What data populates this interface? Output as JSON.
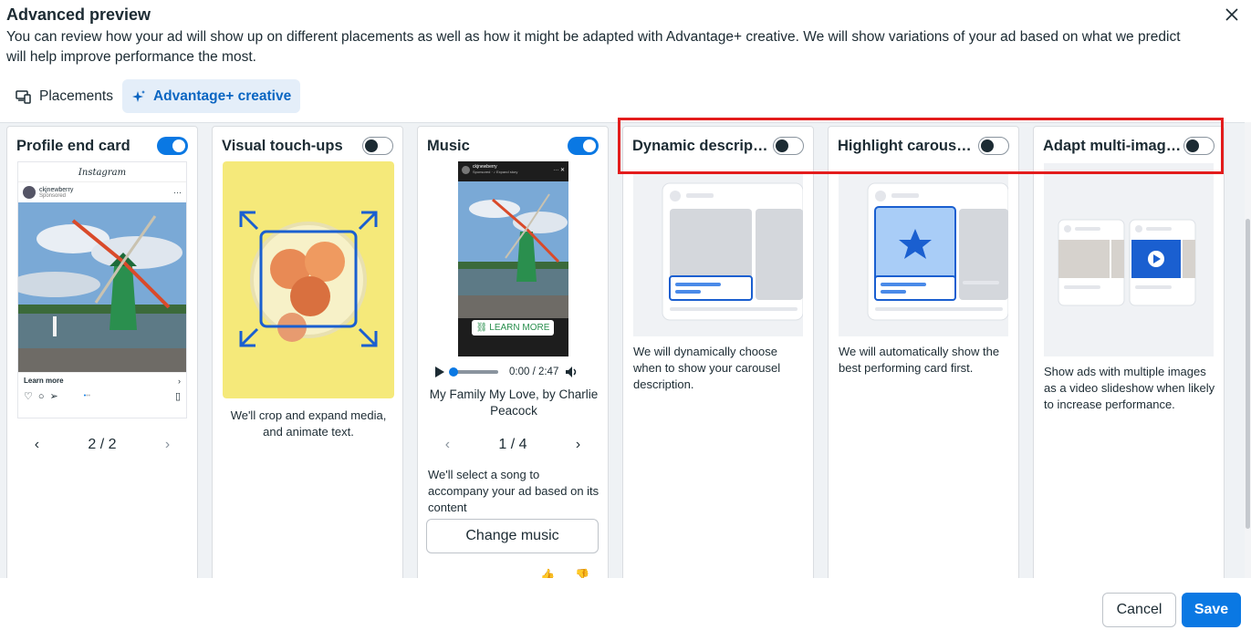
{
  "dialog": {
    "title": "Advanced preview",
    "description": "You can review how your ad will show up on different placements as well as how it might be adapted with Advantage+ creative. We will show variations of your ad based on what we predict will help improve performance the most."
  },
  "tabs": [
    {
      "label": "Placements",
      "icon": "devices-icon",
      "active": false
    },
    {
      "label": "Advantage+ creative",
      "icon": "sparkle-icon",
      "active": true
    }
  ],
  "cards": {
    "profile_end_card": {
      "title": "Profile end card",
      "toggle": "on",
      "ig_logo": "Instagram",
      "username": "ckjnewberry",
      "sponsored": "Sponsored",
      "cta": "Learn more",
      "page": "2 / 2"
    },
    "visual_touchups": {
      "title": "Visual touch-ups",
      "toggle": "off",
      "description": "We'll crop and expand media, and animate text."
    },
    "music": {
      "title": "Music",
      "toggle": "on",
      "story_user": "ckjnewberry",
      "story_sub": "Sponsored · ♪ Expand story",
      "cta": "LEARN MORE",
      "time": "0:00 / 2:47",
      "song": "My Family My Love, by Charlie Peacock",
      "page": "1 / 4",
      "description": "We'll select a song to accompany your ad based on its content",
      "change_button": "Change music"
    },
    "dynamic_description": {
      "title": "Dynamic descrip…",
      "toggle": "off",
      "description": "We will dynamically choose when to show your carousel description."
    },
    "highlight_carousel": {
      "title": "Highlight carouse…",
      "toggle": "off",
      "description": "We will automatically show the best performing card first."
    },
    "adapt_multi_image": {
      "title": "Adapt multi-imag…",
      "toggle": "off",
      "description": "Show ads with multiple images as a video slideshow when likely to increase performance."
    }
  },
  "footer": {
    "cancel": "Cancel",
    "save": "Save"
  },
  "colors": {
    "accent": "#0a78e3",
    "highlight_box": "#e31c1c"
  }
}
